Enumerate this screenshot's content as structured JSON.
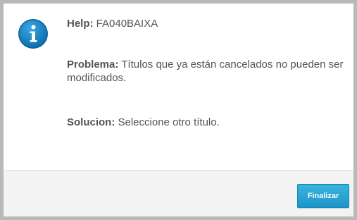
{
  "dialog": {
    "help_label": "Help:",
    "help_value": "FA040BAIXA",
    "problem_label": "Problema:",
    "problem_text": "Títulos que ya están cancelados no pueden ser modificados.",
    "solution_label": "Solucion:",
    "solution_text": "Seleccione otro título.",
    "icon": "info-icon",
    "accent_color": "#1f8fcd"
  },
  "footer": {
    "finish_label": "Finalizar"
  }
}
